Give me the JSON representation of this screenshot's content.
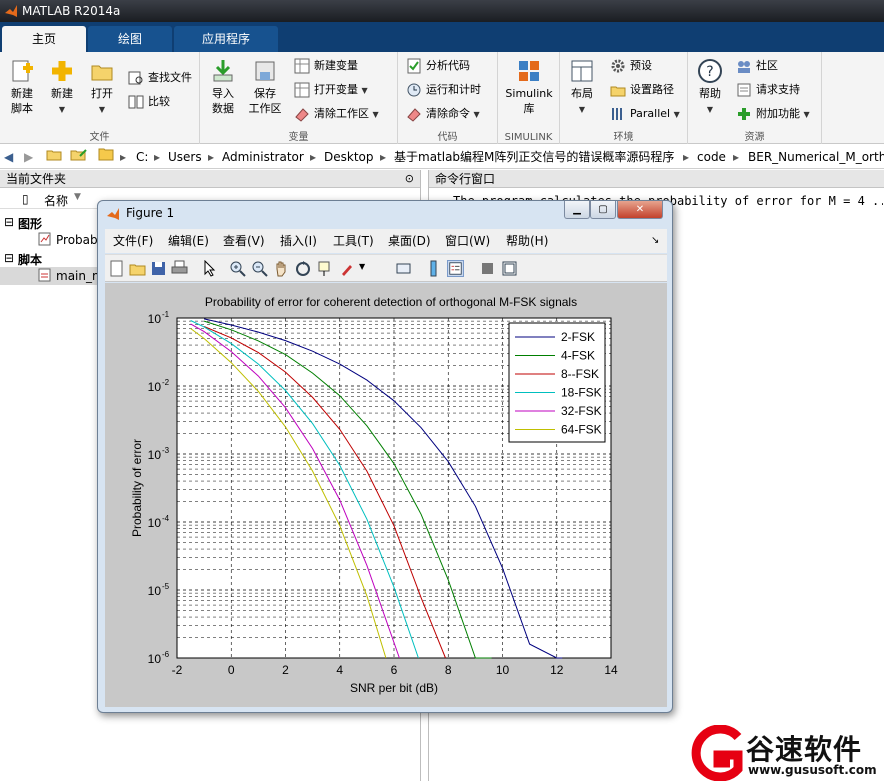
{
  "window": {
    "title": "MATLAB R2014a"
  },
  "tabs": [
    {
      "label": "主页"
    },
    {
      "label": "绘图"
    },
    {
      "label": "应用程序"
    }
  ],
  "ribbon": {
    "file": {
      "label": "文件",
      "new_script": [
        "新建",
        "脚本"
      ],
      "new": "新建",
      "open": "打开",
      "find_files": "查找文件",
      "compare": "比较"
    },
    "variable": {
      "label": "变量",
      "import": [
        "导入",
        "数据"
      ],
      "save": [
        "保存",
        "工作区"
      ],
      "new_var": "新建变量",
      "open_var": "打开变量",
      "clear_ws": "清除工作区"
    },
    "code": {
      "label": "代码",
      "analyze": "分析代码",
      "run_time": "运行和计时",
      "clear_cmd": "清除命令"
    },
    "simulink": {
      "label": "SIMULINK",
      "lib": [
        "Simulink",
        "库"
      ]
    },
    "env": {
      "label": "环境",
      "layout": "布局",
      "prefs": "预设",
      "set_path": "设置路径",
      "parallel": "Parallel"
    },
    "resources": {
      "label": "资源",
      "help": "帮助",
      "community": "社区",
      "support": "请求支持",
      "addons": "附加功能"
    }
  },
  "address": [
    "C:",
    "Users",
    "Administrator",
    "Desktop",
    "基于matlab编程M阵列正交信号的错误概率源码程序",
    "code",
    "BER_Numerical_M_orthogonal"
  ],
  "current_folder": {
    "title": "当前文件夹",
    "col_name": "名称",
    "group_figures": "图形",
    "figure_file": "Probab",
    "group_scripts": "脚本",
    "script_file": "main_m"
  },
  "command_window": {
    "title": "命令行窗口",
    "text": "The program calculates the probability of error for M = 4 ..."
  },
  "figure": {
    "title": "Figure 1",
    "menu": [
      "文件(F)",
      "编辑(E)",
      "查看(V)",
      "插入(I)",
      "工具(T)",
      "桌面(D)",
      "窗口(W)",
      "帮助(H)"
    ]
  },
  "chart_data": {
    "type": "line",
    "title": "Probability of error for coherent detection of orthogonal M-FSK signals",
    "xlabel": "SNR per bit (dB)",
    "ylabel": "Probability of error",
    "xlim": [
      -2,
      14
    ],
    "ylim": [
      1e-06,
      0.1
    ],
    "yscale": "log",
    "grid": true,
    "legend_position": "top-right",
    "x_ticks": [
      "-2",
      "0",
      "2",
      "4",
      "6",
      "8",
      "10",
      "12",
      "14"
    ],
    "y_ticks": [
      "10",
      "10",
      "10",
      "10",
      "10",
      "10"
    ],
    "y_tick_exponents": [
      "-6",
      "-5",
      "-4",
      "-3",
      "-2",
      "-1"
    ],
    "series": [
      {
        "name": "2-FSK",
        "color": "#00007f",
        "x": [
          -1,
          0,
          1,
          2,
          3,
          4,
          5,
          6,
          7,
          8,
          9,
          10,
          11,
          12,
          12.2
        ],
        "y": [
          0.097,
          0.079,
          0.062,
          0.0465,
          0.0325,
          0.021,
          0.0122,
          0.00605,
          0.00244,
          0.00077,
          0.00017,
          2.1e-05,
          1.6e-06,
          5e-08,
          1e-06
        ]
      },
      {
        "name": "4-FSK",
        "color": "#007f00",
        "x": [
          -1,
          0,
          1,
          2,
          3,
          4,
          5,
          6,
          7,
          8,
          9,
          9.6
        ],
        "y": [
          0.09,
          0.067,
          0.046,
          0.029,
          0.0155,
          0.0072,
          0.0026,
          0.00072,
          0.00013,
          1.4e-05,
          9e-07,
          1e-06
        ]
      },
      {
        "name": "8--FSK",
        "color": "#bf0000",
        "x": [
          -1,
          0,
          1,
          2,
          3,
          4,
          5,
          6,
          7,
          7.9
        ],
        "y": [
          0.075,
          0.051,
          0.031,
          0.016,
          0.0068,
          0.0023,
          0.00056,
          8.8e-05,
          7.7e-06,
          1e-06
        ]
      },
      {
        "name": "18-FSK",
        "color": "#00bfbf",
        "x": [
          -1.5,
          -1,
          0,
          1,
          2,
          3,
          4,
          5,
          6,
          6.9
        ],
        "y": [
          0.092,
          0.074,
          0.042,
          0.021,
          0.0086,
          0.0028,
          0.00068,
          0.00011,
          1.1e-05,
          1e-06
        ]
      },
      {
        "name": "32-FSK",
        "color": "#bf00bf",
        "x": [
          -1.5,
          -1,
          0,
          1,
          2,
          3,
          4,
          5,
          6.2
        ],
        "y": [
          0.082,
          0.063,
          0.032,
          0.014,
          0.0048,
          0.0012,
          0.00021,
          2.3e-05,
          1e-06
        ]
      },
      {
        "name": "64-FSK",
        "color": "#bfbf00",
        "x": [
          -1.5,
          -1,
          0,
          1,
          2,
          3,
          4,
          5,
          5.7
        ],
        "y": [
          0.07,
          0.05,
          0.022,
          0.0083,
          0.0025,
          0.00056,
          8.8e-05,
          8.2e-06,
          1e-06
        ]
      }
    ]
  },
  "watermark": {
    "brand": "谷速软件",
    "url": "www.gususoft.com",
    "color": "#e60012"
  }
}
